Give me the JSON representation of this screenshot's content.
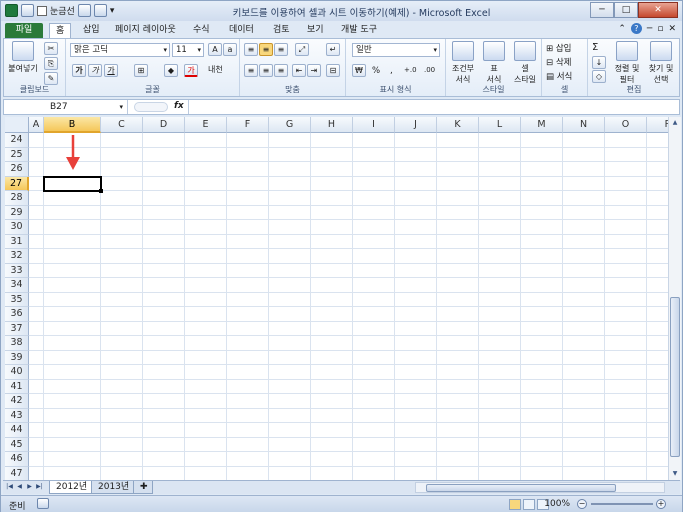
{
  "window": {
    "title": "키보드를 이용하여 셀과 시트 이동하기(예제) - Microsoft Excel",
    "qat_label": "눈금선",
    "buttons": {
      "minimize": "─",
      "restore": "□",
      "close": "✕"
    }
  },
  "tabs": [
    {
      "label": "파일",
      "active": false
    },
    {
      "label": "홈",
      "active": true
    },
    {
      "label": "삽입",
      "active": false
    },
    {
      "label": "페이지 레이아웃",
      "active": false
    },
    {
      "label": "수식",
      "active": false
    },
    {
      "label": "데이터",
      "active": false
    },
    {
      "label": "검토",
      "active": false
    },
    {
      "label": "보기",
      "active": false
    },
    {
      "label": "개발 도구",
      "active": false
    }
  ],
  "ribbon": {
    "clipboard": {
      "paste": "붙여넣기",
      "label": "클립보드"
    },
    "font": {
      "name": "맑은 고딕",
      "size": "11",
      "bold": "가",
      "italic": "가",
      "underline": "가",
      "label": "글꼴",
      "phonetic": "내천",
      "fontcolor": "가"
    },
    "align": {
      "label": "맞춤"
    },
    "number": {
      "format": "일반",
      "percent": "%",
      "comma": ",",
      "inc": "+.0",
      "dec": ".00",
      "label": "표시 형식"
    },
    "styles": {
      "cond": "조건부\n서식",
      "table": "표\n서식",
      "cell": "셀\n스타일",
      "label": "스타일"
    },
    "cells": {
      "insert": "삽입",
      "delete": "삭제",
      "format": "서식",
      "label": "셀"
    },
    "edit": {
      "sum": "Σ",
      "sort": "정렬 및\n필터",
      "find": "찾기 및\n선택",
      "label": "편집"
    }
  },
  "formula_bar": {
    "name_box": "B27",
    "fx": "fx",
    "value": ""
  },
  "columns": [
    "A",
    "B",
    "C",
    "D",
    "E",
    "F",
    "G",
    "H",
    "I",
    "J",
    "K",
    "L",
    "M",
    "N",
    "O",
    "P"
  ],
  "rows": [
    "24",
    "25",
    "26",
    "27",
    "28",
    "29",
    "30",
    "31",
    "32",
    "33",
    "34",
    "35",
    "36",
    "37",
    "38",
    "39",
    "40",
    "41",
    "42",
    "43",
    "44",
    "45",
    "46",
    "47"
  ],
  "selection": {
    "column": "B",
    "row": "27"
  },
  "sheets": [
    {
      "label": "2012년",
      "active": true
    },
    {
      "label": "2013년",
      "active": false
    }
  ],
  "status": {
    "ready": "준비",
    "zoom": "100%"
  },
  "colors": {
    "accent_arrow": "#e8403a",
    "file_tab": "#2b7a39",
    "header_highlight": "#f5c75a"
  }
}
